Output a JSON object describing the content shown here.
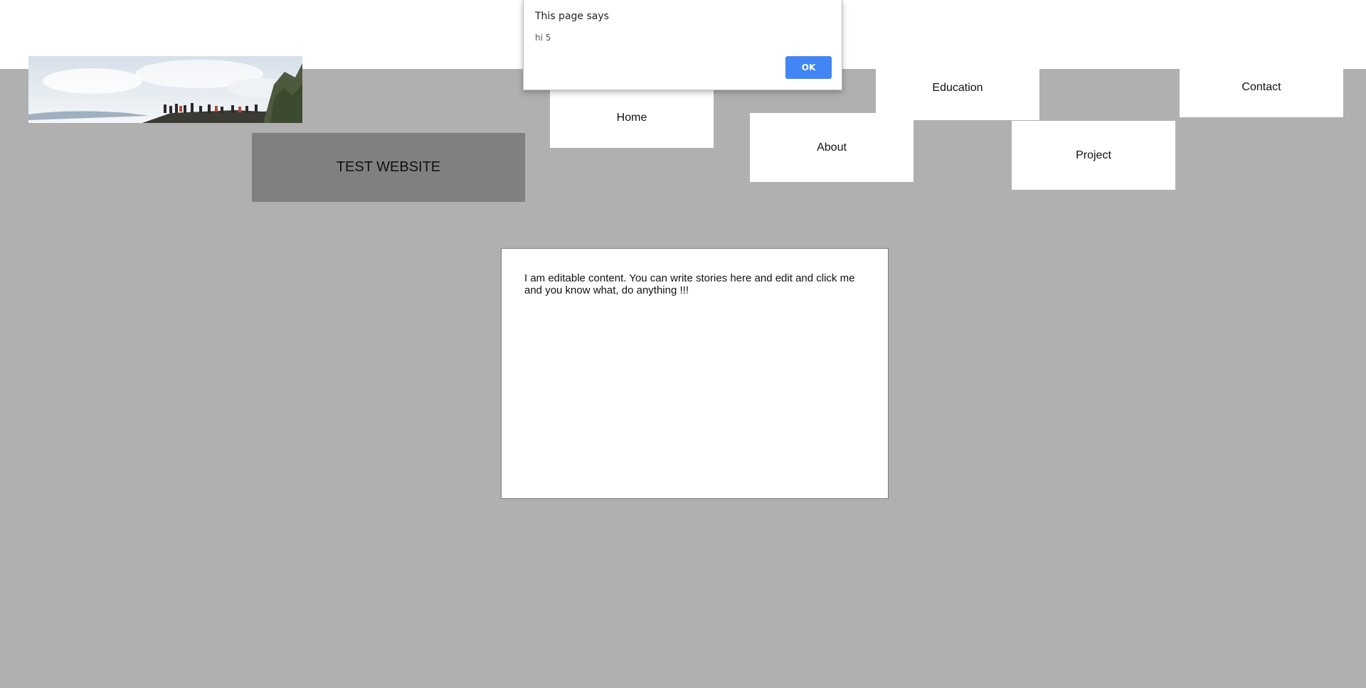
{
  "dialog": {
    "title": "This page says",
    "message": "hi 5",
    "ok_label": "OK",
    "button_color": "#4285f4"
  },
  "header": {
    "site_title": "TEST WEBSITE"
  },
  "nav": {
    "home": "Home",
    "about": "About",
    "education": "Education",
    "project": "Project",
    "contact": "Contact"
  },
  "content": {
    "editable_text": "I am editable content. You can write stories here and edit and click me and you know what, do anything !!!"
  },
  "colors": {
    "page_background": "#b0b0b0",
    "title_background": "#808080",
    "nav_background": "#ffffff"
  }
}
